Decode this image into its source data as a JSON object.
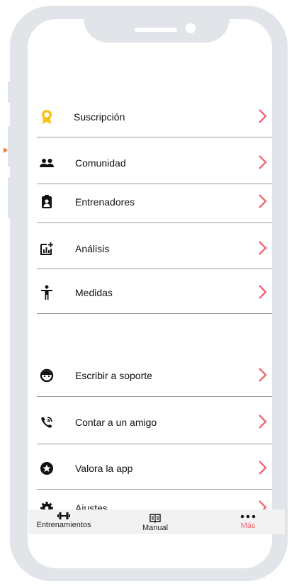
{
  "menu": {
    "items": [
      {
        "label": "Suscripción",
        "icon": "award-icon"
      },
      {
        "label": "Comunidad",
        "icon": "people-icon"
      },
      {
        "label": "Entrenadores",
        "icon": "badge-icon"
      },
      {
        "label": "Análisis",
        "icon": "analytics-icon"
      },
      {
        "label": "Medidas",
        "icon": "person-icon"
      }
    ],
    "support_items": [
      {
        "label": "Escribir a soporte",
        "icon": "support-face-icon"
      },
      {
        "label": "Contar a un amigo",
        "icon": "wifi-call-icon"
      },
      {
        "label": "Valora la app",
        "icon": "star-circle-icon"
      },
      {
        "label": "Ajustes",
        "icon": "gear-icon"
      }
    ]
  },
  "tabbar": {
    "tabs": [
      {
        "label": "Entrenamientos",
        "icon": "dumbbell-icon",
        "active": false
      },
      {
        "label": "Manual",
        "icon": "book-icon",
        "active": false
      },
      {
        "label": "Más",
        "icon": "more-dots-icon",
        "active": true
      }
    ]
  },
  "colors": {
    "accent": "#f06a72",
    "award": "#f7c21a",
    "frame": "#e1e4e8",
    "divider": "#9a9a9a",
    "tabbar_bg": "#f2f2f2"
  }
}
